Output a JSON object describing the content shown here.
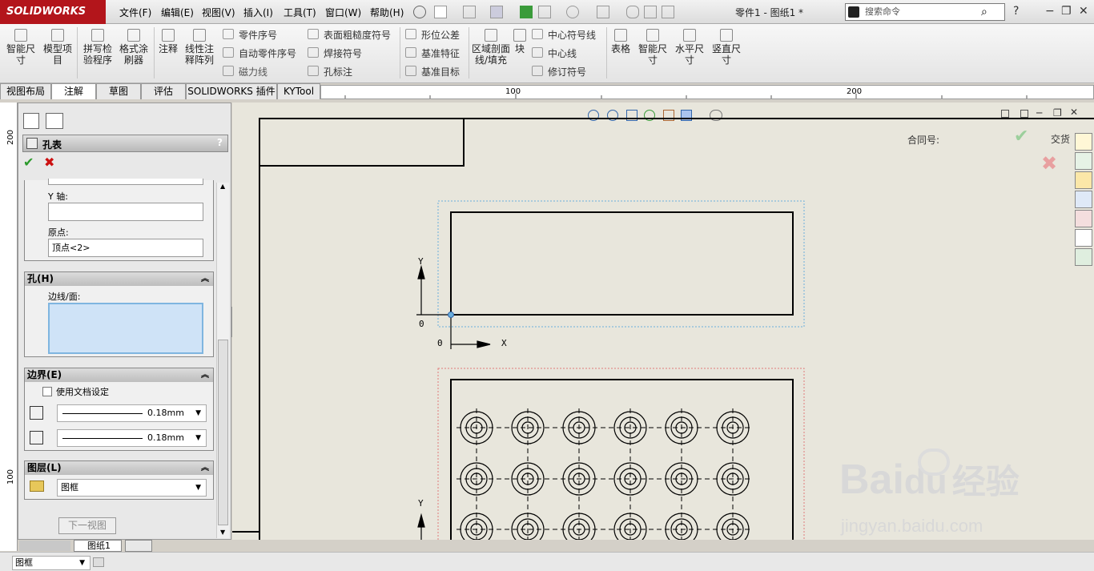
{
  "app": {
    "logo": "SOLIDWORKS",
    "doc_title": "零件1 - 图纸1 *"
  },
  "menu": [
    "文件(F)",
    "编辑(E)",
    "视图(V)",
    "插入(I)",
    "工具(T)",
    "窗口(W)",
    "帮助(H)"
  ],
  "search": {
    "placeholder": "搜索命令"
  },
  "toolbar": {
    "big": [
      "智能尺寸",
      "模型项目",
      "拼写检验程序",
      "格式涂刷器",
      "注释",
      "线性注释阵列",
      "区域剖面线/填充",
      "块",
      "表格",
      "智能尺寸",
      "水平尺寸",
      "竖直尺寸"
    ],
    "small": [
      "零件序号",
      "自动零件序号",
      "磁力线",
      "表面粗糙度符号",
      "焊接符号",
      "孔标注",
      "形位公差",
      "基准特征",
      "基准目标",
      "中心符号线",
      "中心线",
      "修订符号"
    ]
  },
  "tabs": [
    "视图布局",
    "注解",
    "草图",
    "评估",
    "SOLIDWORKS 插件",
    "KYTool"
  ],
  "ruler": {
    "h": [
      "100",
      "200"
    ],
    "v": [
      "200",
      "100"
    ]
  },
  "pm": {
    "title": "孔表",
    "y_axis_label": "Y 轴:",
    "origin_label": "原点:",
    "origin_value": "顶点<2>",
    "hole_section": "孔(H)",
    "edge_face_label": "边线/面:",
    "border_section": "边界(E)",
    "use_doc_label": "使用文档设定",
    "line1": "0.18mm",
    "line2": "0.18mm",
    "layer_section": "图层(L)",
    "layer_value": "图框",
    "next_view": "下一视图"
  },
  "sheet_tab": "图纸1",
  "drawing": {
    "contract_label": "合同号:",
    "delivery_label": "交货",
    "axis_y": "Y",
    "axis_x": "X",
    "origin": "0"
  },
  "status": {
    "layer": "图框"
  },
  "watermark": {
    "brand": "Bai",
    "brand2": "du",
    "cn": "经验",
    "url": "jingyan.baidu.com"
  }
}
